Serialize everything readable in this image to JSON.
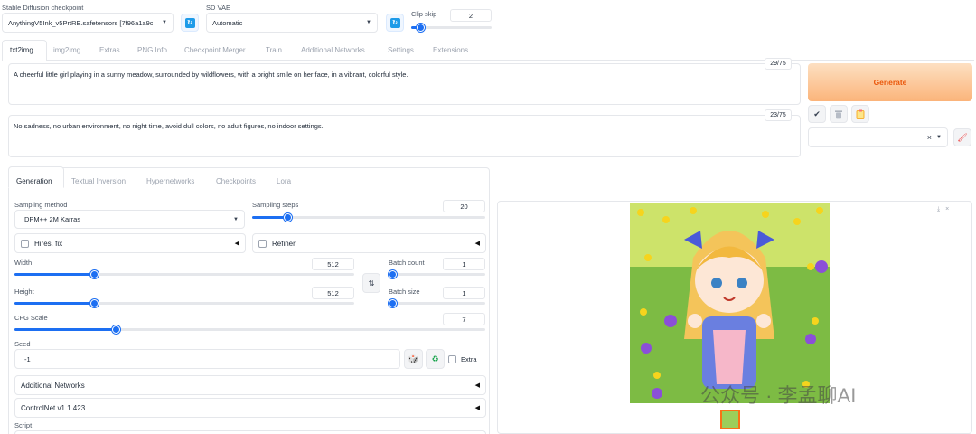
{
  "checkpoint": {
    "label": "Stable Diffusion checkpoint",
    "value": "AnythingV5Ink_v5PrtRE.safetensors [7f96a1a9c"
  },
  "vae": {
    "label": "SD VAE",
    "value": "Automatic"
  },
  "clip_skip": {
    "label": "Clip skip",
    "value": "2",
    "fraction": 0.08
  },
  "main_tabs": [
    {
      "label": "txt2img"
    },
    {
      "label": "img2img"
    },
    {
      "label": "Extras"
    },
    {
      "label": "PNG Info"
    },
    {
      "label": "Checkpoint Merger"
    },
    {
      "label": "Train"
    },
    {
      "label": "Additional Networks"
    },
    {
      "label": "Settings"
    },
    {
      "label": "Extensions"
    }
  ],
  "prompt": {
    "text": "A cheerful little girl playing in a sunny meadow, surrounded by wildflowers, with a bright smile on her face, in a vibrant, colorful style.",
    "counter": "29/75"
  },
  "negative_prompt": {
    "text": "No sadness, no urban environment, no night time, avoid dull colors, no adult figures, no indoor settings.",
    "counter": "23/75"
  },
  "generate_label": "Generate",
  "sub_tabs": [
    {
      "label": "Generation"
    },
    {
      "label": "Textual Inversion"
    },
    {
      "label": "Hypernetworks"
    },
    {
      "label": "Checkpoints"
    },
    {
      "label": "Lora"
    }
  ],
  "sampling_method": {
    "label": "Sampling method",
    "value": "DPM++ 2M Karras"
  },
  "sampling_steps": {
    "label": "Sampling steps",
    "value": "20",
    "fraction": 0.14
  },
  "hires_fix": {
    "label": "Hires. fix"
  },
  "refiner": {
    "label": "Refiner"
  },
  "width": {
    "label": "Width",
    "value": "512",
    "fraction": 0.23
  },
  "height": {
    "label": "Height",
    "value": "512",
    "fraction": 0.23
  },
  "batch_count": {
    "label": "Batch count",
    "value": "1",
    "fraction": 0.0
  },
  "batch_size": {
    "label": "Batch size",
    "value": "1",
    "fraction": 0.0
  },
  "cfg_scale": {
    "label": "CFG Scale",
    "value": "7",
    "fraction": 0.21
  },
  "seed": {
    "label": "Seed",
    "value": "-1",
    "extra_label": "Extra"
  },
  "additional_networks": {
    "label": "Additional Networks"
  },
  "controlnet": {
    "label": "ControlNet v1.1.423"
  },
  "script": {
    "label": "Script"
  },
  "watermark": {
    "text": "公众号 · 李孟聊AI"
  },
  "icons": {
    "refresh": "refresh-icon",
    "check": "check-icon",
    "trash": "trash-icon",
    "clipboard": "clipboard-icon",
    "brush": "brush-icon",
    "swap": "swap-icon",
    "dice": "dice-icon",
    "recycle": "recycle-icon"
  },
  "colors": {
    "accent": "#1d6ff2",
    "generate_start": "#fcd6b0",
    "generate_end": "#fba86b",
    "generate_text": "#ea580c"
  }
}
